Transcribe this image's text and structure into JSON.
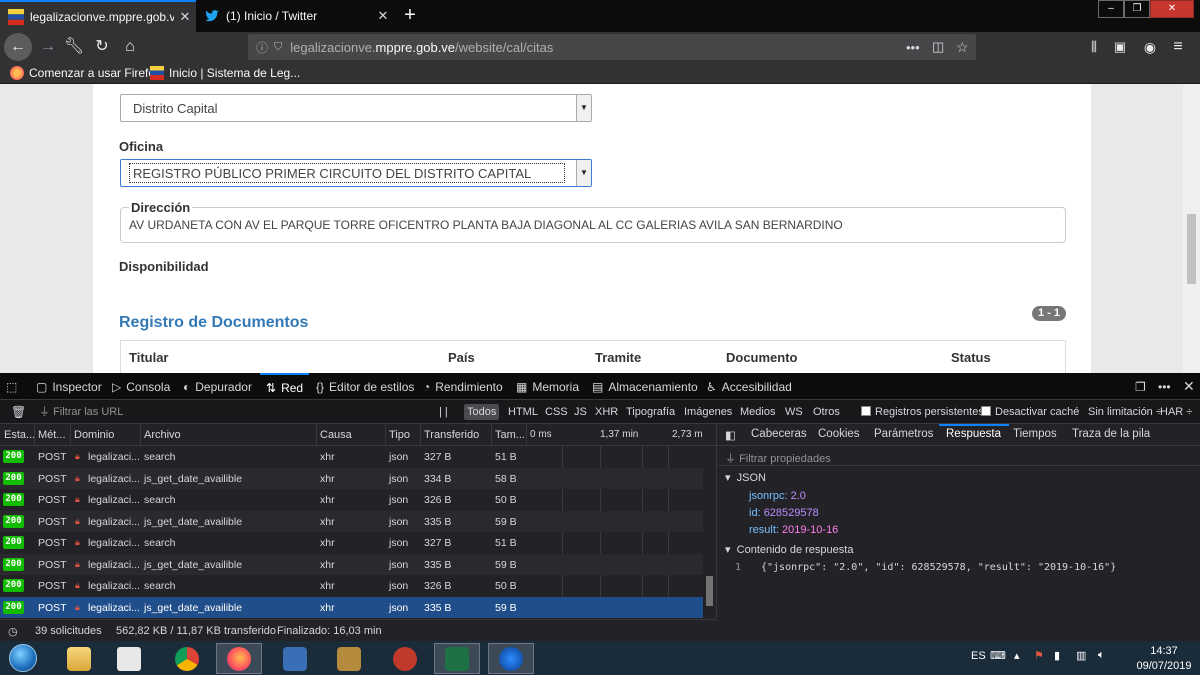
{
  "browser": {
    "tabs": [
      {
        "title": "legalizacionve.mppre.gob.ve/w",
        "active": true
      },
      {
        "title": "(1) Inicio / Twitter",
        "active": false
      }
    ],
    "url_prefix": "legalizacionve.",
    "url_domain": "mppre.gob.ve",
    "url_path": "/website/cal/citas",
    "url_more": "•••",
    "bookmarks": [
      {
        "label": "Comenzar a usar Firefox"
      },
      {
        "label": "Inicio | Sistema de Leg..."
      }
    ]
  },
  "form": {
    "estado_value": "Distrito Capital",
    "oficina_label": "Oficina",
    "oficina_value": "REGISTRO PÚBLICO PRIMER CIRCUITO DEL DISTRITO CAPITAL",
    "direccion_label": "Dirección",
    "direccion_value": "AV URDANETA CON AV EL PARQUE TORRE OFICENTRO PLANTA BAJA DIAGONAL AL CC GALERIAS AVILA SAN BERNARDINO",
    "disponibilidad_label": "Disponibilidad"
  },
  "registro": {
    "title": "Registro de Documentos",
    "badge": "1 - 1",
    "columns": [
      "Titular",
      "País",
      "Tramite",
      "Documento",
      "Status"
    ]
  },
  "devtools": {
    "tabs": [
      "Inspector",
      "Consola",
      "Depurador",
      "Red",
      "Editor de estilos",
      "Rendimiento",
      "Memoria",
      "Almacenamiento",
      "Accesibilidad"
    ],
    "selected_tab": "Red",
    "filter_placeholder": "Filtrar las URL",
    "pause": "| |",
    "types": [
      "Todos",
      "HTML",
      "CSS",
      "JS",
      "XHR",
      "Tipografía",
      "Imágenes",
      "Medios",
      "WS",
      "Otros"
    ],
    "persist_label": "Registros persistentes",
    "cache_label": "Desactivar caché",
    "throttle_label": "Sin limitación ÷",
    "har_label": "HAR ÷",
    "columns": [
      "Esta...",
      "Mét...",
      "Dominio",
      "Archivo",
      "Causa",
      "Tipo",
      "Transferido",
      "Tam...",
      "0 ms",
      "1,37 min",
      "2,73 m"
    ],
    "requests": [
      {
        "status": "200",
        "method": "POST",
        "domain": "legalizaci...",
        "file": "search",
        "cause": "xhr",
        "type": "json",
        "transferred": "327 B",
        "size": "51 B"
      },
      {
        "status": "200",
        "method": "POST",
        "domain": "legalizaci...",
        "file": "js_get_date_availible",
        "cause": "xhr",
        "type": "json",
        "transferred": "334 B",
        "size": "58 B"
      },
      {
        "status": "200",
        "method": "POST",
        "domain": "legalizaci...",
        "file": "search",
        "cause": "xhr",
        "type": "json",
        "transferred": "326 B",
        "size": "50 B"
      },
      {
        "status": "200",
        "method": "POST",
        "domain": "legalizaci...",
        "file": "js_get_date_availible",
        "cause": "xhr",
        "type": "json",
        "transferred": "335 B",
        "size": "59 B"
      },
      {
        "status": "200",
        "method": "POST",
        "domain": "legalizaci...",
        "file": "search",
        "cause": "xhr",
        "type": "json",
        "transferred": "327 B",
        "size": "51 B"
      },
      {
        "status": "200",
        "method": "POST",
        "domain": "legalizaci...",
        "file": "js_get_date_availible",
        "cause": "xhr",
        "type": "json",
        "transferred": "335 B",
        "size": "59 B"
      },
      {
        "status": "200",
        "method": "POST",
        "domain": "legalizaci...",
        "file": "search",
        "cause": "xhr",
        "type": "json",
        "transferred": "326 B",
        "size": "50 B"
      },
      {
        "status": "200",
        "method": "POST",
        "domain": "legalizaci...",
        "file": "js_get_date_availible",
        "cause": "xhr",
        "type": "json",
        "transferred": "335 B",
        "size": "59 B",
        "selected": true
      }
    ],
    "detail_tabs": [
      "Cabeceras",
      "Cookies",
      "Parámetros",
      "Respuesta",
      "Tiempos",
      "Traza de la pila"
    ],
    "detail_selected": "Respuesta",
    "filter_props_placeholder": "Filtrar propiedades",
    "json_section": "JSON",
    "json_fields": [
      {
        "key": "jsonrpc",
        "value": "2.0",
        "kind": "n"
      },
      {
        "key": "id",
        "value": "628529578",
        "kind": "n"
      },
      {
        "key": "result",
        "value": "2019-10-16",
        "kind": "s"
      }
    ],
    "raw_section": "Contenido de respuesta",
    "raw_line_no": "1",
    "raw_body": "{\"jsonrpc\": \"2.0\", \"id\": 628529578, \"result\": \"2019-10-16\"}",
    "status_requests": "39 solicitudes",
    "status_size": "562,82 KB / 11,87 KB transferido",
    "status_finished": "Finalizado: 16,03 min"
  },
  "taskbar": {
    "lang": "ES",
    "time": "14:37",
    "date": "09/07/2019"
  },
  "colors": {
    "accent": "#0a84ff",
    "status_ok": "#12bc00",
    "link_title": "#337ab7"
  }
}
